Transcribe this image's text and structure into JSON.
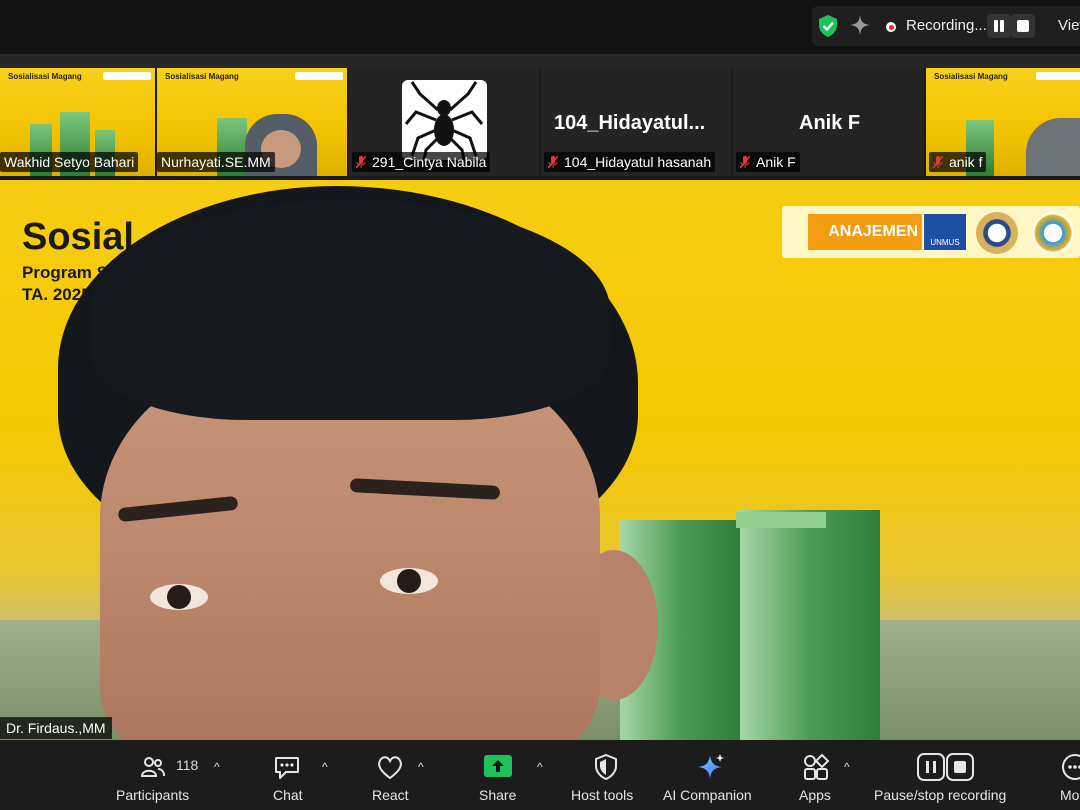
{
  "topbar": {
    "recording_label": "Recording...",
    "view_label": "View",
    "icons": [
      "security-shield-icon",
      "ai-sparkle-icon",
      "recording-dot-icon",
      "pause-icon",
      "stop-icon"
    ]
  },
  "thumbnails": [
    {
      "name": "Wakhid Setyo Bahari",
      "muted": false,
      "slide_title": "Sosialisasi Magang"
    },
    {
      "name": "Nurhayati.SE.MM",
      "muted": false
    },
    {
      "name": "291_Cintya Nabila",
      "muted": true
    },
    {
      "name": "104_Hidayatul hasanah",
      "muted": true,
      "display_name": "104_Hidayatul..."
    },
    {
      "name": "Anik F",
      "muted": true,
      "display_name": "Anik F"
    },
    {
      "name": "anik f",
      "muted": true,
      "slide_title": "Sosialisasi Magang"
    }
  ],
  "main_view": {
    "slide_title": "Sosial",
    "slide_sub1": "Program St",
    "slide_sub2": "TA. 2025/2",
    "logo_text": "ANAJEMEN",
    "logo2_text": "UNMUS",
    "speaker_name": "Dr. Firdaus.,MM"
  },
  "toolbar": {
    "participants_label": "Participants",
    "participants_count": "118",
    "chat_label": "Chat",
    "react_label": "React",
    "share_label": "Share",
    "host_tools_label": "Host tools",
    "ai_companion_label": "AI Companion",
    "apps_label": "Apps",
    "pause_stop_label": "Pause/stop recording",
    "more_label": "More"
  },
  "colors": {
    "accent_green": "#1fc25a",
    "slide_yellow": "#f4c800",
    "record_red": "#e02828"
  }
}
